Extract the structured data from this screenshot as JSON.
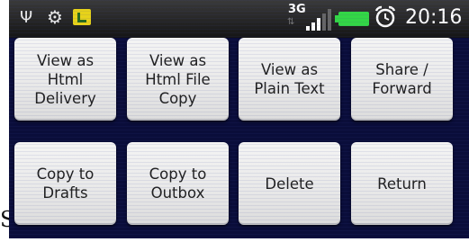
{
  "leading_text": "S",
  "status_bar": {
    "icons": [
      "usb-icon",
      "android-debug-icon",
      "sd-card-icon",
      "3g-network-icon",
      "signal-strength-icon",
      "battery-icon",
      "alarm-clock-icon"
    ],
    "network_label": "3G",
    "time": "20:16",
    "colors": {
      "battery": "#33d646",
      "debug_badge": "#e7d21a"
    }
  },
  "buttons": {
    "view_html_delivery": "View as\nHtml\nDelivery",
    "view_html_file_copy": "View as\nHtml File\nCopy",
    "view_plain_text": "View as\nPlain Text",
    "share_forward": "Share /\nForward",
    "copy_drafts": "Copy to\nDrafts",
    "copy_outbox": "Copy to\nOutbox",
    "delete": "Delete",
    "return": "Return"
  },
  "colors": {
    "background": "#0a0d3a",
    "button": "#eeeeee"
  }
}
